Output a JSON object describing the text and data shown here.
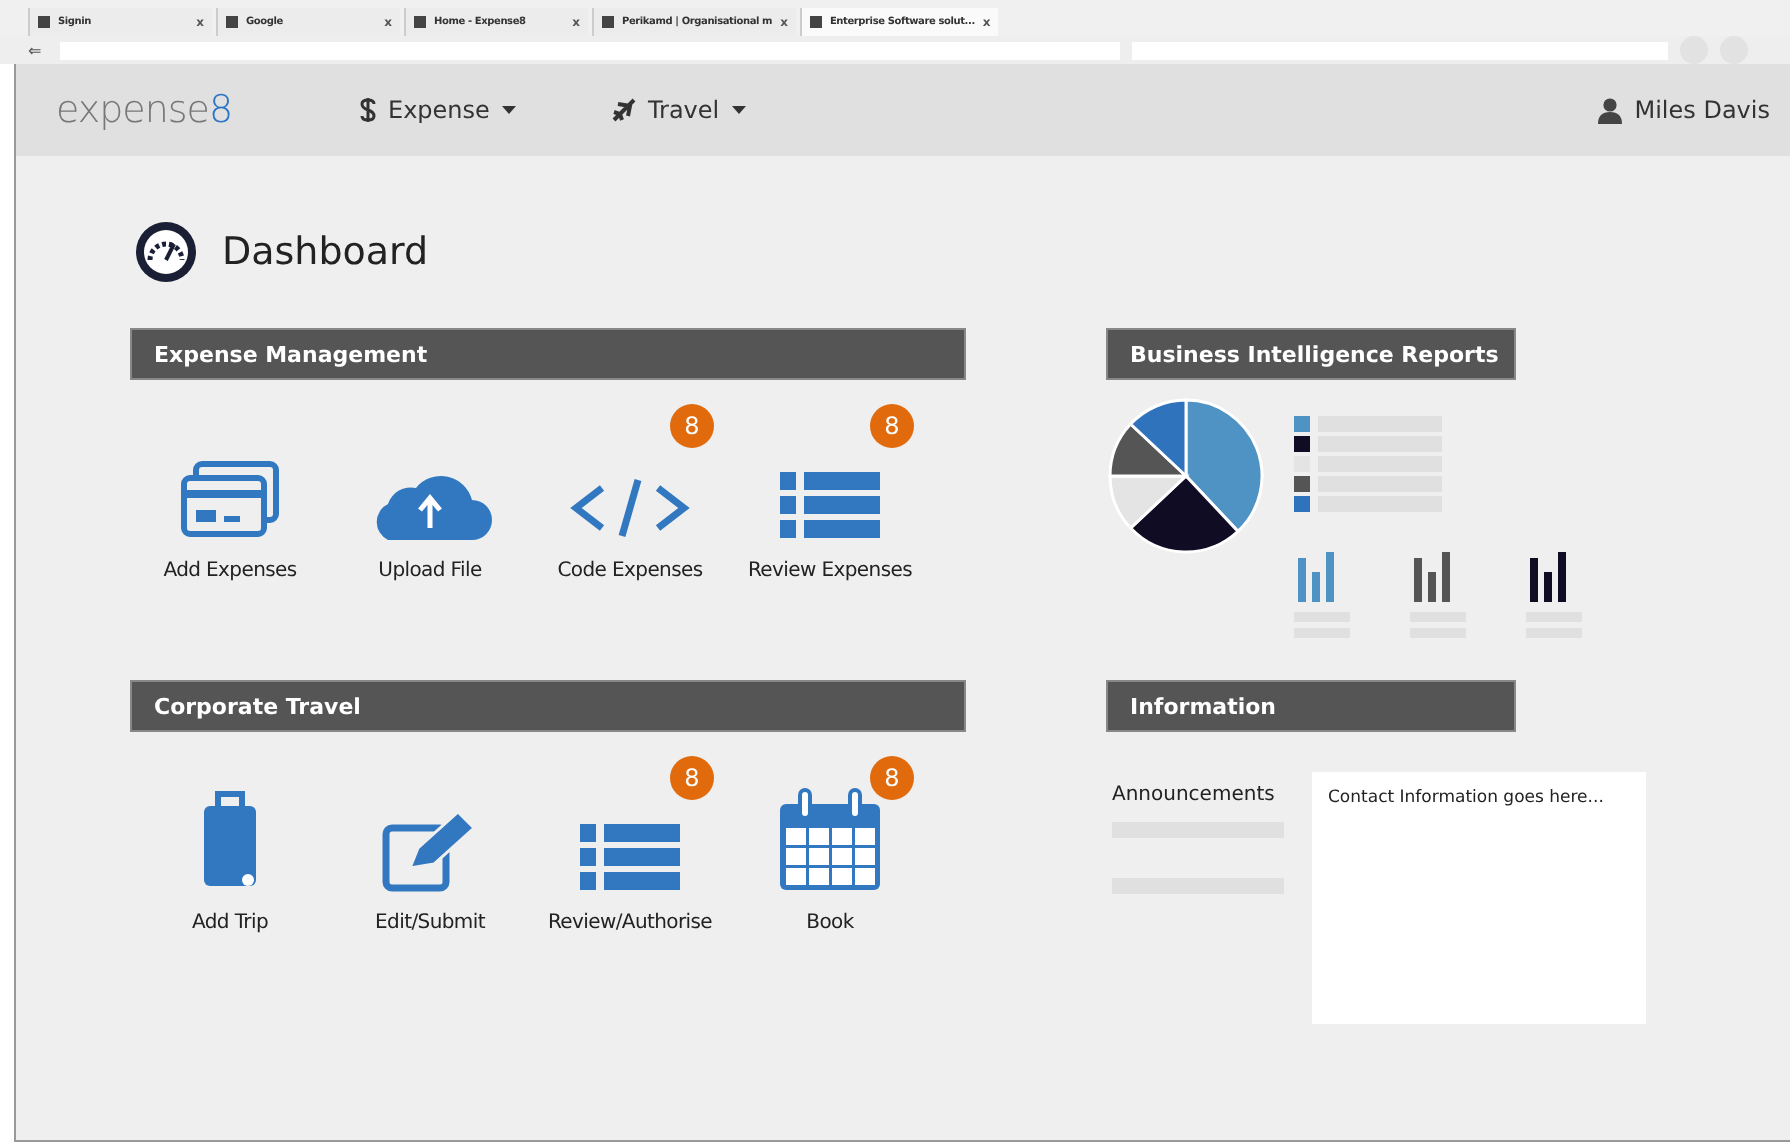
{
  "browser": {
    "tabs": [
      {
        "label": "Signin",
        "selected": false,
        "close": "x"
      },
      {
        "label": "Google",
        "selected": false,
        "close": "x"
      },
      {
        "label": "Home - Expense8",
        "selected": false,
        "close": "x"
      },
      {
        "label": "Perikamd | Organisational m",
        "selected": false,
        "close": "x"
      },
      {
        "label": "Enterprise Software solut...",
        "selected": true,
        "close": "x"
      }
    ],
    "back_glyph": "⇐"
  },
  "header": {
    "logo": {
      "text": "expense",
      "accent": "8"
    },
    "menus": [
      {
        "kind": "dollar",
        "label": "Expense"
      },
      {
        "kind": "plane",
        "label": "Travel"
      }
    ],
    "user": "Miles Davis"
  },
  "page": {
    "title": "Dashboard"
  },
  "sections": [
    {
      "title": "Expense Management",
      "tiles": [
        {
          "kind": "card",
          "label": "Add Expenses"
        },
        {
          "kind": "cloud",
          "label": "Upload File"
        },
        {
          "kind": "code",
          "label": "Code Expenses",
          "badge": "8"
        },
        {
          "kind": "list",
          "label": "Review Expenses",
          "badge": "8"
        }
      ]
    },
    {
      "title": "Corporate Travel",
      "tiles": [
        {
          "kind": "luggage",
          "label": "Add Trip"
        },
        {
          "kind": "edit",
          "label": "Edit/Submit"
        },
        {
          "kind": "list",
          "label": "Review/Authorise",
          "badge": "8"
        },
        {
          "kind": "calendar",
          "label": "Book",
          "badge": "8"
        }
      ]
    }
  ],
  "reports": {
    "title": "Business Intelligence Reports"
  },
  "information": {
    "title": "Information",
    "announcements": "Announcements",
    "contact": "Contact Information goes here..."
  }
}
